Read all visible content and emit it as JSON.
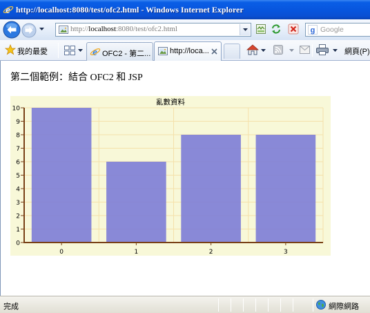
{
  "window": {
    "title": "http://localhost:8080/test/ofc2.html - Windows Internet Explorer"
  },
  "navigation": {
    "address": {
      "scheme": "http://",
      "domain": "localhost",
      "path": ":8080/test/ofc2.html"
    },
    "search_placeholder": "Google"
  },
  "favorites_bar": {
    "favorites_label": "我的最愛"
  },
  "tabs": [
    {
      "label": "OFC2 - 第二...",
      "icon": "ie-icon",
      "active": false
    },
    {
      "label": "http://loca...",
      "icon": "page-icon",
      "active": true
    }
  ],
  "command_bar": {
    "page_menu_label": "網頁(P)"
  },
  "page": {
    "heading": "第二個範例：結合 OFC2 和 JSP"
  },
  "chart_data": {
    "type": "bar",
    "title": "亂數資料",
    "categories": [
      "0",
      "1",
      "2",
      "3"
    ],
    "values": [
      10,
      6,
      8,
      8
    ],
    "ylim": [
      0,
      10
    ],
    "y_ticks": [
      0,
      1,
      2,
      3,
      4,
      5,
      6,
      7,
      8,
      9,
      10
    ],
    "xlabel": "",
    "ylabel": "",
    "grid": true,
    "legend": "none",
    "colors": {
      "bar": "#8080d6",
      "background": "#f8f8d8",
      "axis": "#784016",
      "grid": "#f5e1aa"
    }
  },
  "status_bar": {
    "status_text": "完成",
    "zone_label": "網際網路"
  },
  "icons": {
    "title": "ie-icon",
    "back": "back-arrow-icon",
    "forward": "forward-arrow-icon",
    "address_page": "page-icon",
    "compatibility": "compatibility-view-icon",
    "refresh": "refresh-icon",
    "stop": "stop-icon",
    "search_provider": "google-icon",
    "favorites": "star-icon",
    "quick_tabs": "quick-tabs-icon",
    "tab_close": "close-icon",
    "home": "home-icon",
    "feeds": "feeds-icon",
    "mail": "mail-icon",
    "print": "print-icon",
    "zone": "globe-icon"
  },
  "colors": {
    "title_bar": "#0855dd",
    "title_text": "#ffffff",
    "url_domain": "#000000",
    "url_muted": "#7d7d7d"
  }
}
